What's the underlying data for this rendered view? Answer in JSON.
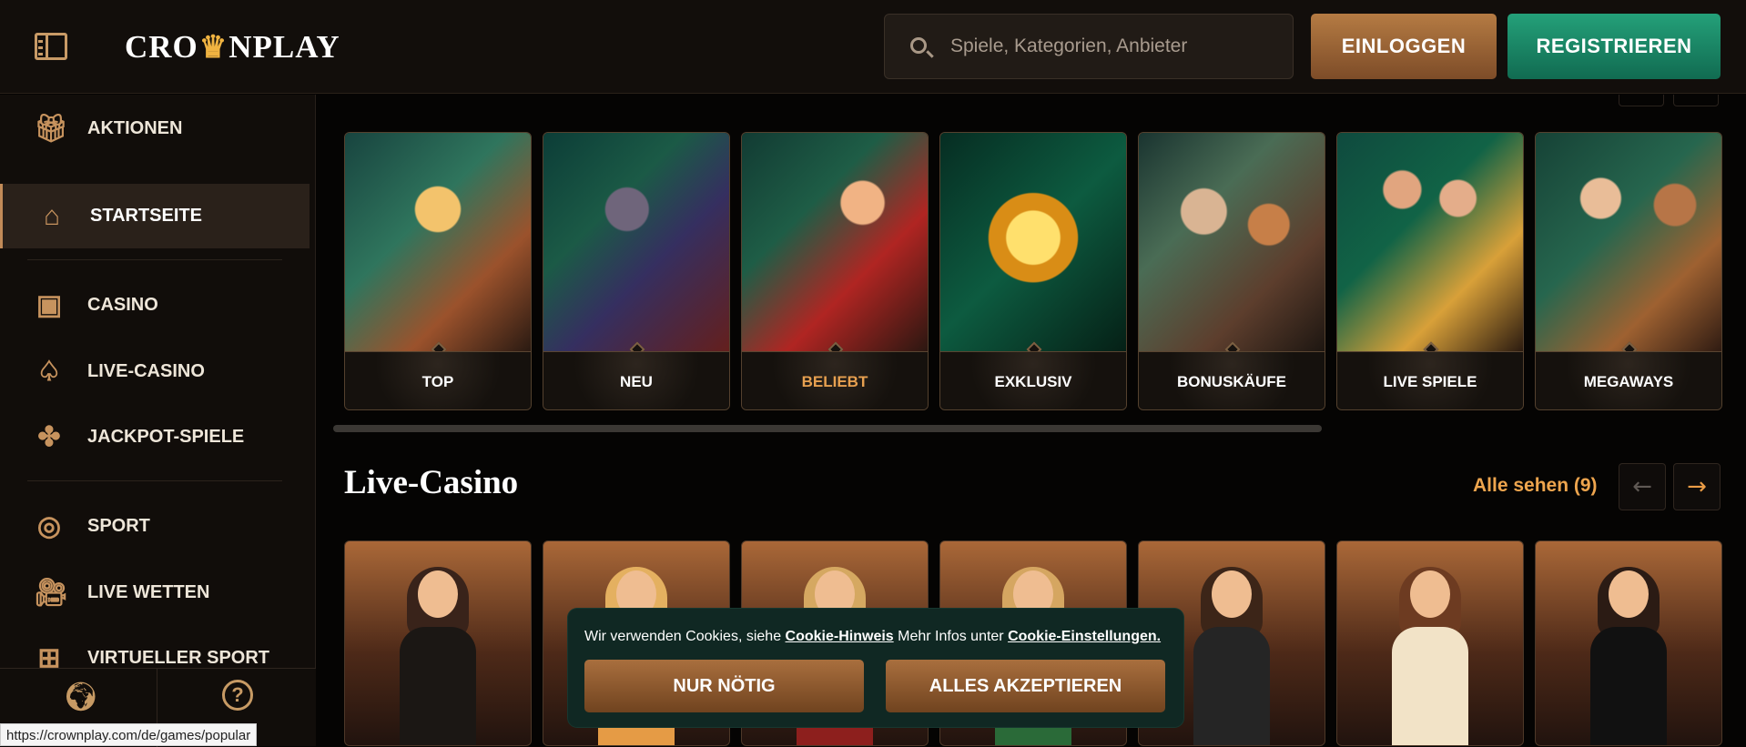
{
  "brand": {
    "left": "CRO",
    "right": "NPLAY"
  },
  "search": {
    "placeholder": "Spiele, Kategorien, Anbieter"
  },
  "header": {
    "login_label": "EINLOGGEN",
    "register_label": "REGISTRIEREN"
  },
  "sidebar": {
    "items": [
      {
        "label": "AKTIONEN",
        "icon": "gift-icon"
      },
      {
        "label": "STARTSEITE",
        "icon": "home-icon"
      },
      {
        "label": "CASINO",
        "icon": "slot-machine-icon"
      },
      {
        "label": "LIVE-CASINO",
        "icon": "spade-icon"
      },
      {
        "label": "JACKPOT-SPIELE",
        "icon": "clover-icon"
      },
      {
        "label": "SPORT",
        "icon": "soccer-ball-icon"
      },
      {
        "label": "LIVE WETTEN",
        "icon": "camera-icon"
      },
      {
        "label": "VIRTUELLER SPORT",
        "icon": "gamepad-icon"
      }
    ]
  },
  "categories": [
    {
      "label": "TOP"
    },
    {
      "label": "NEU"
    },
    {
      "label": "BELIEBT"
    },
    {
      "label": "EXKLUSIV"
    },
    {
      "label": "BONUSKÄUFE"
    },
    {
      "label": "LIVE SPIELE"
    },
    {
      "label": "MEGAWAYS"
    }
  ],
  "live_casino": {
    "title": "Live-Casino",
    "see_all": "Alle sehen (9)"
  },
  "cookie": {
    "text_before": "Wir verwenden Cookies, siehe ",
    "hint_link": "Cookie-Hinweis",
    "text_middle": " Mehr Infos unter ",
    "settings_link": "Cookie-Einstellungen.",
    "necessary_button": "NUR NÖTIG",
    "accept_all_button": "ALLES AKZEPTIEREN"
  },
  "status_url": "https://crownplay.com/de/games/popular",
  "colors": {
    "accent": "#e7a050",
    "login": "#9b6533",
    "register": "#1a8c68",
    "cookie_bg": "#102823"
  }
}
